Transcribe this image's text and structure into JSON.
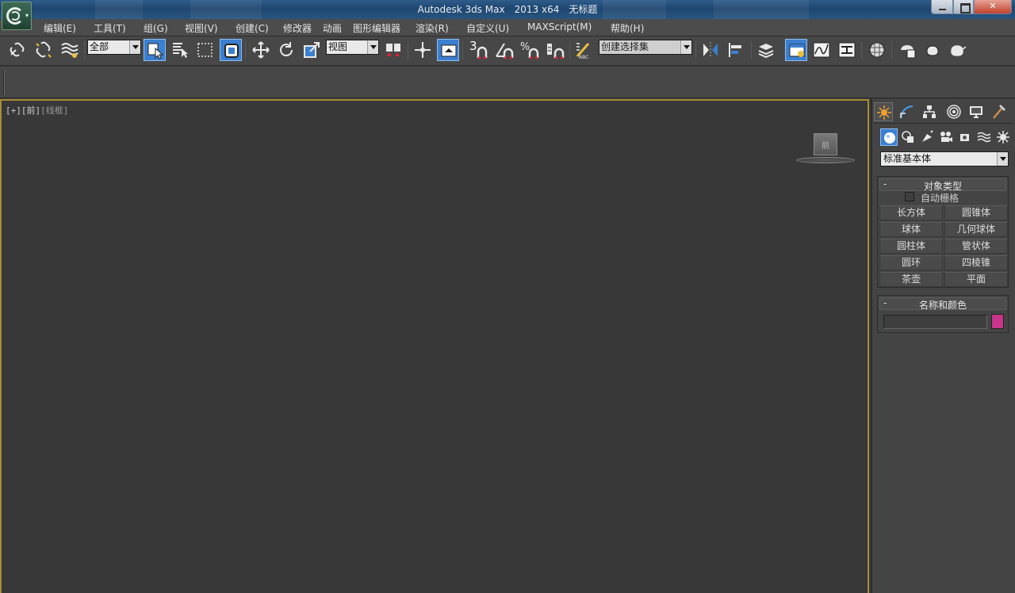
{
  "window": {
    "app_name": "Autodesk 3ds Max",
    "version": "2013 x64",
    "document": "无标题"
  },
  "menu": [
    "编辑(E)",
    "工具(T)",
    "组(G)",
    "视图(V)",
    "创建(C)",
    "修改器",
    "动画",
    "图形编辑器",
    "渲染(R)",
    "自定义(U)",
    "MAXScript(M)",
    "帮助(H)"
  ],
  "toolbar": {
    "selection_filter": "全部",
    "reference_coord": "视图",
    "snap_value": "3",
    "named_selection_placeholder": "创建选择集"
  },
  "viewport": {
    "label_plus": "[+]",
    "label_view": "[前]",
    "label_mode": "[线框]",
    "viewcube_face": "前"
  },
  "command_panel": {
    "category": "标准基本体",
    "object_type": {
      "title": "对象类型",
      "autogrid": "自动栅格",
      "buttons": [
        "长方体",
        "圆锥体",
        "球体",
        "几何球体",
        "圆柱体",
        "管状体",
        "圆环",
        "四棱锥",
        "茶壶",
        "平面"
      ]
    },
    "name_color": {
      "title": "名称和颜色",
      "name_value": "",
      "color": "#c8348a"
    }
  },
  "colors": {
    "active_blue": "#3b7fd0",
    "viewport_border": "#a88c36"
  }
}
